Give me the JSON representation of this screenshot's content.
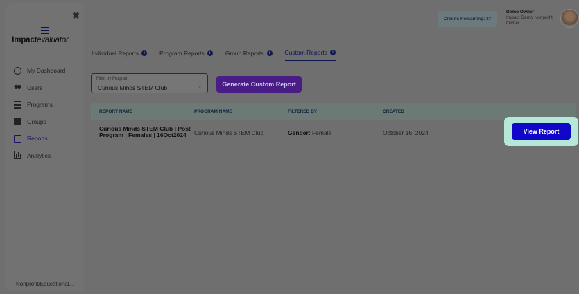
{
  "sidebar": {
    "brand_main": "Impact",
    "brand_sub": "evaluator",
    "items": [
      {
        "label": "My Dashboard",
        "icon": "user-circle-icon"
      },
      {
        "label": "Users",
        "icon": "users-icon"
      },
      {
        "label": "Programs",
        "icon": "list-icon"
      },
      {
        "label": "Groups",
        "icon": "group-box-icon"
      },
      {
        "label": "Reports",
        "icon": "document-icon",
        "active": true
      },
      {
        "label": "Analytics",
        "icon": "bar-chart-icon"
      }
    ],
    "org_label": "Nonprofit/Educational..."
  },
  "header": {
    "credits_label": "Credits Remaining: 37",
    "user_name": "Demo Owner",
    "user_org": "Impact Demo Nonprofit",
    "user_role": "Owner"
  },
  "tabs": [
    {
      "label": "Individual Reports",
      "active": false
    },
    {
      "label": "Program Reports",
      "active": false
    },
    {
      "label": "Group Reports",
      "active": false
    },
    {
      "label": "Custom Reports",
      "active": true
    }
  ],
  "filter": {
    "label": "Filter by Program",
    "value": "Curious Minds STEM Club"
  },
  "generate_button": "Generate Custom Report",
  "table": {
    "headers": [
      "REPORT NAME",
      "PROGRAM NAME",
      "FILTERED BY",
      "CREATED"
    ],
    "rows": [
      {
        "report_name": "Curious Minds STEM Club | Post Program | Females | 16Oct2024",
        "program_name": "Curious Minds STEM Club",
        "filter_key": "Gender:",
        "filter_value": "Female",
        "created": "October 16, 2024",
        "action": "View Report"
      }
    ]
  },
  "colors": {
    "accent_purple": "#4a1d86",
    "view_button": "#1008c8",
    "highlight": "#b5e8d8"
  }
}
